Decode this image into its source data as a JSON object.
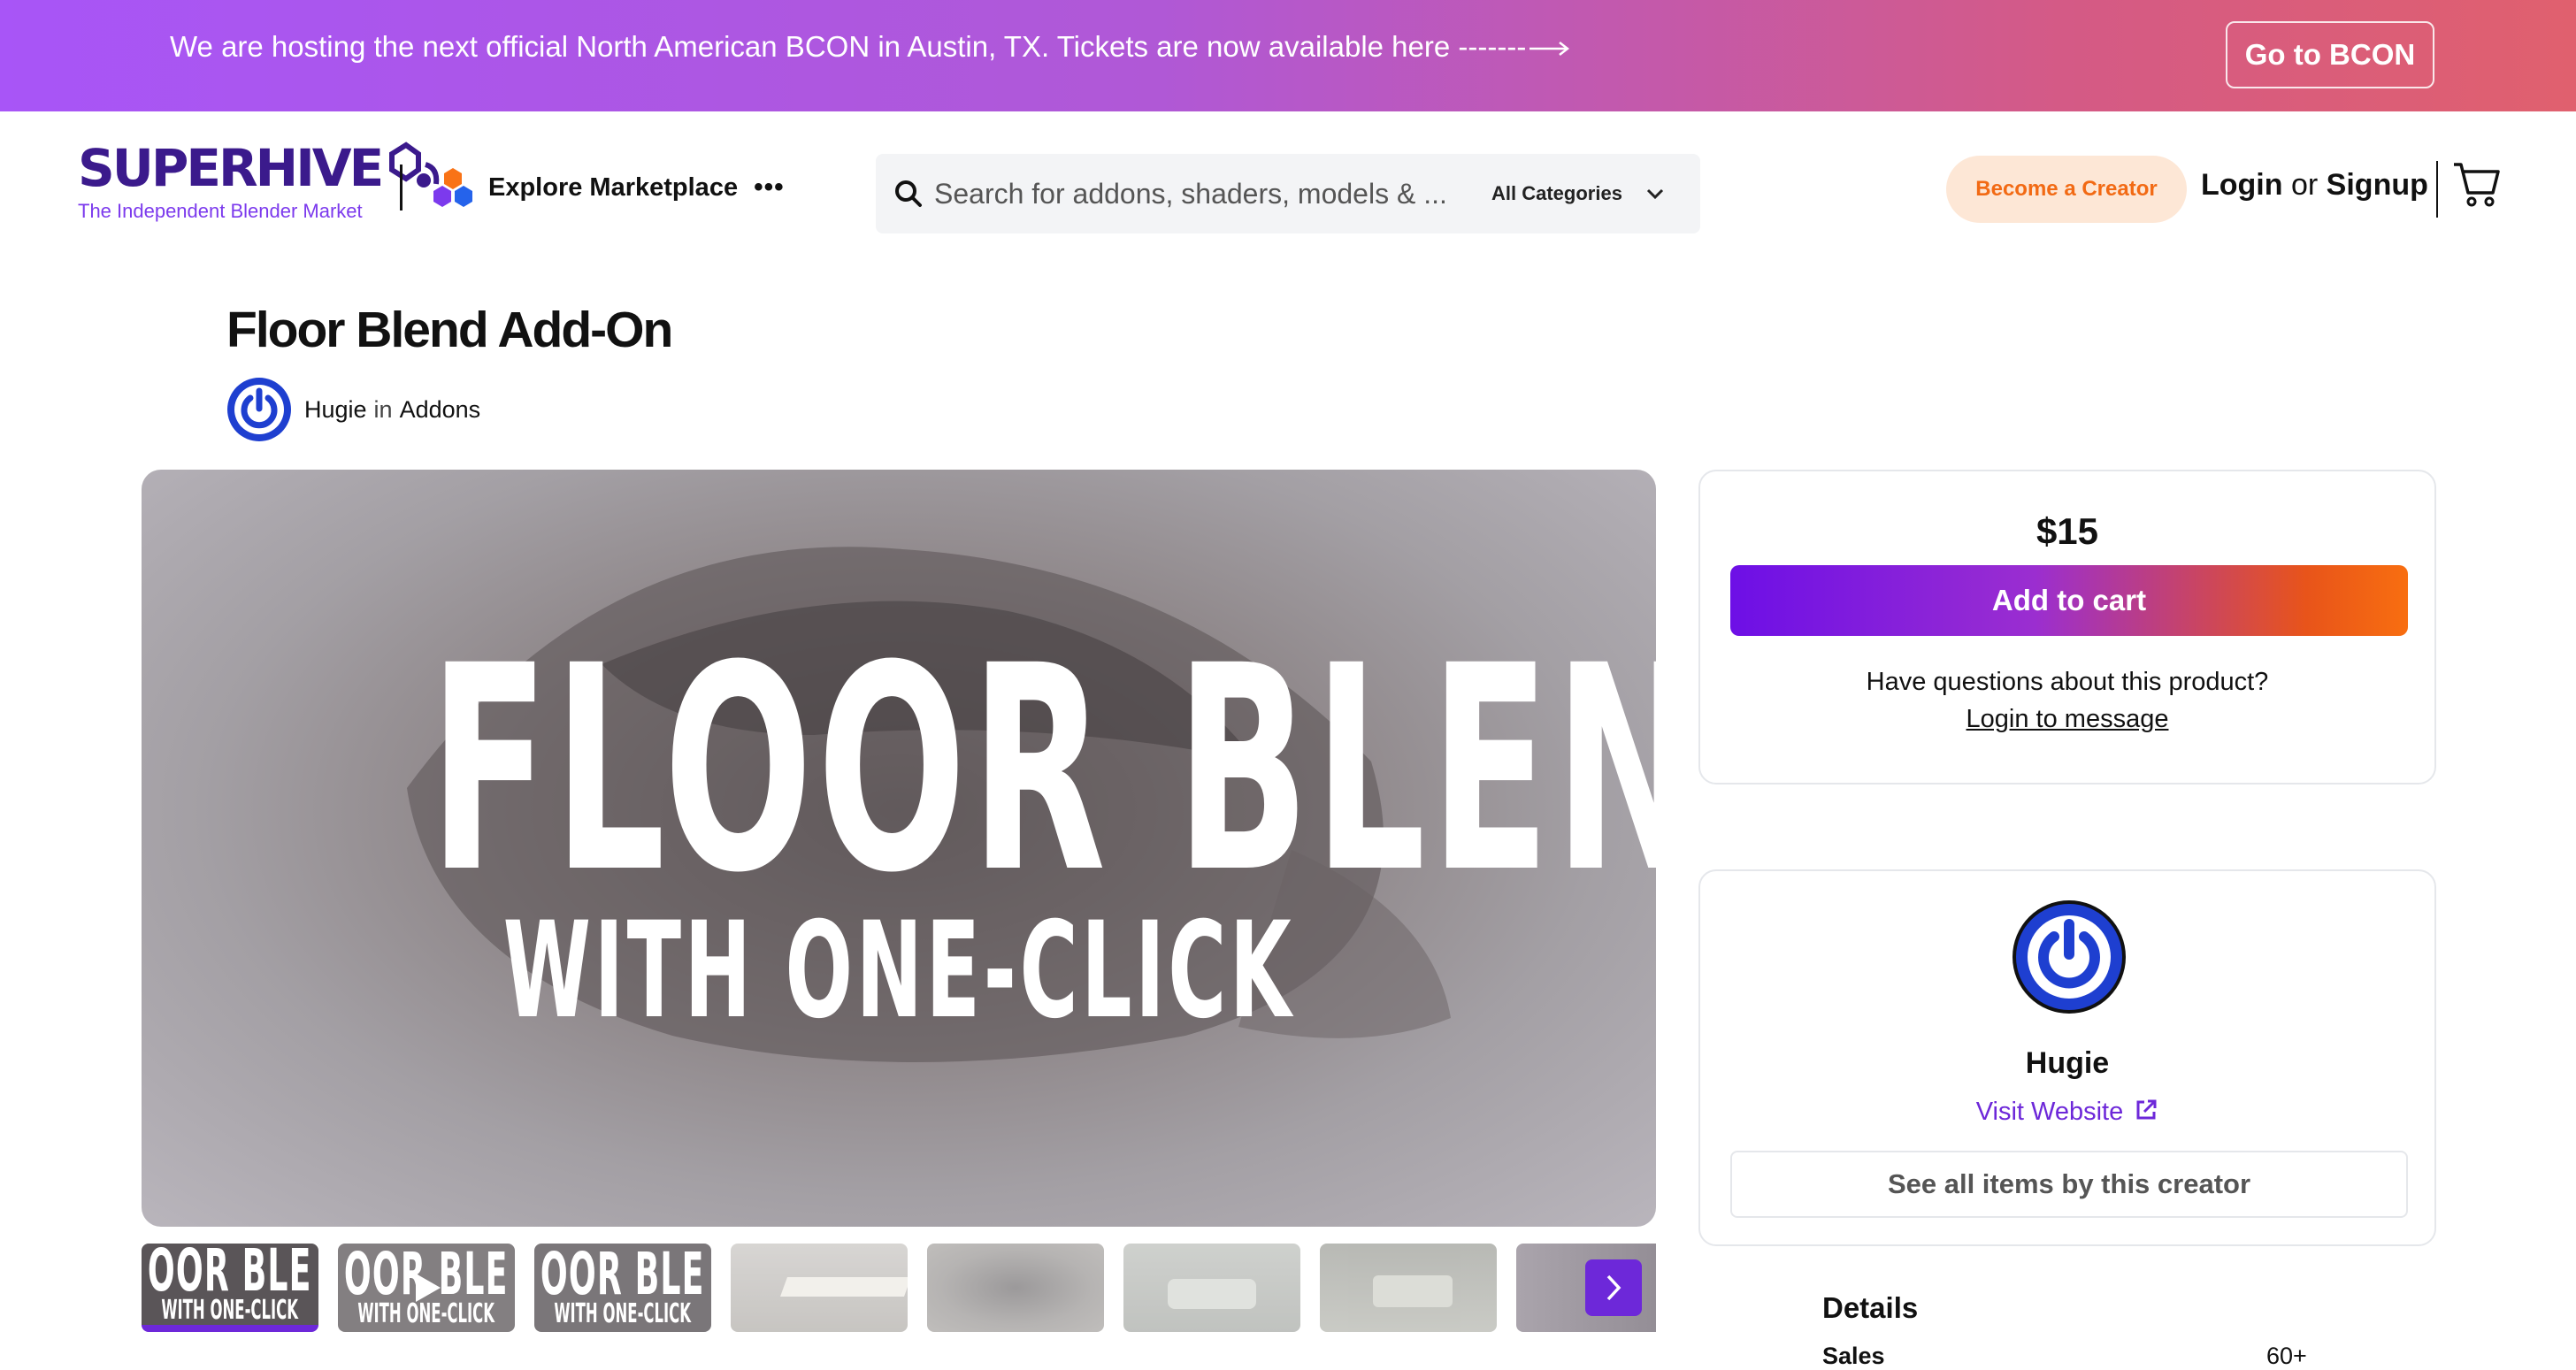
{
  "banner": {
    "text": "We are hosting the next official North American BCON in Austin, TX.  Tickets are now available here -------",
    "button": "Go to BCON"
  },
  "header": {
    "logo_word": "SUPERHIVE",
    "logo_sub": "The Independent Blender Market",
    "explore": "Explore Marketplace",
    "more": "•••",
    "search_placeholder": "Search for addons, shaders, models & ...",
    "category": "All Categories",
    "become_creator": "Become a Creator",
    "login": "Login",
    "or": "or",
    "signup": "Signup"
  },
  "product": {
    "title": "Floor Blend Add-On",
    "creator": "Hugie",
    "in": "in",
    "category": "Addons",
    "hero_line1": "FLOOR BLEND",
    "hero_line2": "WITH ONE-CLICK",
    "thumb_text1": "OOR BLE",
    "thumb_text2": "WITH ONE-CLICK"
  },
  "purchase": {
    "price": "$15",
    "add_to_cart": "Add to cart",
    "question": "Have questions about this product?",
    "login_message": "Login to message"
  },
  "creator_card": {
    "name": "Hugie",
    "visit": "Visit Website",
    "see_all": "See all items by this creator"
  },
  "details": {
    "heading": "Details",
    "sales_label": "Sales",
    "sales_value": "60+"
  },
  "colors": {
    "accent": "#6d28d9",
    "orange": "#f26a14"
  }
}
